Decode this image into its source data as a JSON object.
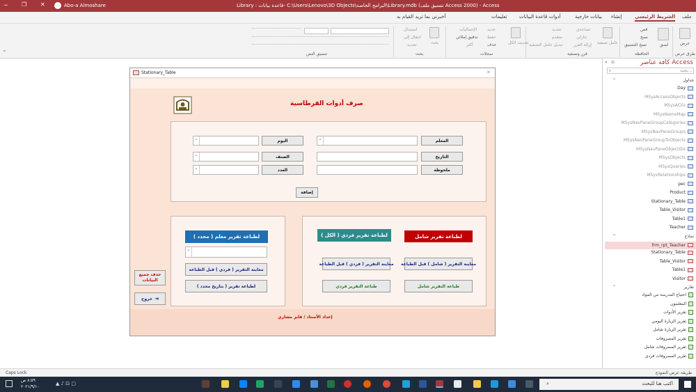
{
  "titlebar": {
    "title": "Library : قاعدة بيانات- C:\\Users\\Lenovo\\3D Objects\\البرامج الخاصة\\Library.mdb (تنسيق ملف Access 2000) - Access",
    "user": "Abo-a Almoshare"
  },
  "tabs": [
    "ملف",
    "الشريط الرئيسي",
    "إنشاء",
    "بيانات خارجية",
    "أدوات قاعدة البيانات",
    "تعليمات",
    "أخبرني بما تريد القيام به"
  ],
  "ribbon": {
    "groups": [
      "طرق عرض",
      "الحافظة",
      "فرز وتصفية",
      "سجلات",
      "بحث",
      "تنسيق النص"
    ],
    "items": {
      "view": "عرض",
      "paste": "لصق",
      "cut": "قص",
      "copy": "نسخ",
      "format_painter": "نسخ التنسيق",
      "filter": "عامل تصفية",
      "ascending": "تصاعدي",
      "descending": "تنازلي",
      "remove_sort": "إزالة الفرز",
      "selection": "تحديد",
      "advanced": "متقدم",
      "toggle_filter": "تبديل عامل التصفية",
      "refresh_all": "تحديث الكل",
      "new": "جديد",
      "save": "حفظ",
      "delete": "حذف",
      "totals": "الإجماليات",
      "spelling": "تدقيق إملائي",
      "more": "أكثر",
      "find": "بحث",
      "replace": "استبدال",
      "goto": "انتقال إلى",
      "select": "تحديد"
    }
  },
  "form": {
    "window_title": "Stationary_Table",
    "header_title": "صرف أدوات القرطاسية",
    "fields": {
      "teacher_label": "المعلم",
      "date_label": "التاريخ",
      "notes_label": "ملحوظة",
      "day_label": "اليوم",
      "class_label": "الصنف",
      "count_label": "العدد"
    },
    "add_button": "إضافة",
    "sections": {
      "full_report": "لطباعة تقرير شامل",
      "individual_all": "لطباعة تقرير فردي ( الكل )",
      "teacher_specific": "لطباعة تقرير معلم ( محدد )"
    },
    "buttons": {
      "preview_full": "معاينة التقرير ( شامل ) قبل الطباعة",
      "print_full": "طباعة التقرير شامل",
      "preview_individual": "معاينة التقرير ( فردي ) قبل الطباعة",
      "print_individual": "طباعة التقرير فردي",
      "preview_teacher": "معاينة التقرير ( فردي ) قبل الطباعة",
      "print_teacher_date": "لطباعة تقرير ( بتاريخ محدد )",
      "delete_all": "حذف جميع البيانات",
      "exit": "خروج"
    },
    "footer": "إعداد الأستاذ / فايز مشاري"
  },
  "nav": {
    "title": "كافة عناصر Access",
    "search_placeholder": "بحث...",
    "tables_header": "جداول",
    "tables": [
      "Day",
      "MSysAccessObjects",
      "MSysACEs",
      "MSysNameMap",
      "MSysNavPaneGroupCategories",
      "MSysNavPaneGroups",
      "MSysNavPaneGroupToObjects",
      "MSysNavPaneObjectIDs",
      "MSysObjects",
      "MSysQueries",
      "MSysRelationships",
      "pec",
      "Product",
      "Stationary_Table",
      "Table_Visitor",
      "Table1",
      "Teacher"
    ],
    "forms_header": "نماذج",
    "forms": [
      "frm_rpt_Teacher",
      "Stationary_Table",
      "Table_Visitor",
      "Table1",
      "Visitor"
    ],
    "reports_header": "تقارير",
    "reports": [
      "احتياج المدرسة من المواد",
      "المعلمون",
      "تقرير الأدوات",
      "تقرير الزيارة اليومي",
      "تقرير الزيارة شامل",
      "تقرير المصروفات",
      "تقرير المصروفات شامل",
      "تقرير المصروفات فردي"
    ]
  },
  "status": {
    "left": "Caps Lock",
    "right": "طريقة عرض النموذج"
  },
  "taskbar": {
    "search_placeholder": "اكتب هنا للبحث",
    "time": "٨:٥٩ ص",
    "date": "٢٠٢١/٩/١٠"
  },
  "colors": {
    "access_red": "#a4373a",
    "form_bg": "#fbe3d6",
    "header_red": "#c00000",
    "header_teal": "#2e8b8b",
    "header_blue": "#1f6fb2",
    "btn_red_text": "#c00000",
    "btn_blue_text": "#1a237e",
    "btn_green_text": "#1b7a2a",
    "selected_nav": "#f8d7da"
  }
}
